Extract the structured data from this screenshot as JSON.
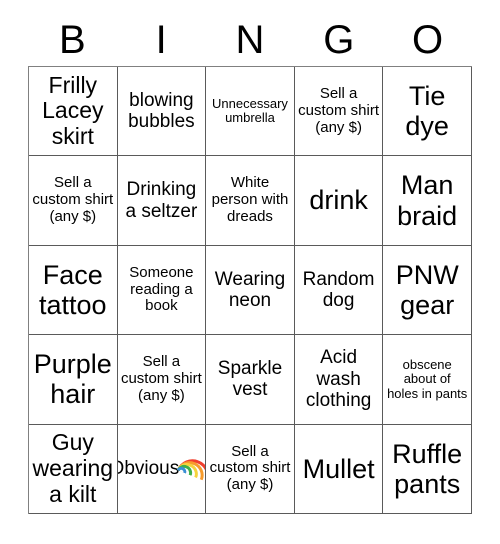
{
  "card": {
    "title": "BINGO",
    "header_letters": [
      "B",
      "I",
      "N",
      "G",
      "O"
    ],
    "background_color": "#ffffff",
    "text_color": "#000000",
    "border_color": "#5a5a5a",
    "rows": [
      [
        {
          "text": "Frilly Lacey skirt",
          "size": "lg"
        },
        {
          "text": "blowing bubbles",
          "size": "md"
        },
        {
          "text": "Unnecessary umbrella",
          "size": "xs"
        },
        {
          "text": "Sell a custom shirt (any $)",
          "size": "sm"
        },
        {
          "text": "Tie dye",
          "size": "xl"
        }
      ],
      [
        {
          "text": "Sell a custom shirt (any $)",
          "size": "sm"
        },
        {
          "text": "Drinking a seltzer",
          "size": "md"
        },
        {
          "text": "White person with dreads",
          "size": "sm"
        },
        {
          "text": "drink",
          "size": "xl"
        },
        {
          "text": "Man braid",
          "size": "xl"
        }
      ],
      [
        {
          "text": "Face tattoo",
          "size": "xl"
        },
        {
          "text": "Someone reading a book",
          "size": "sm"
        },
        {
          "text": "Wearing neon",
          "size": "md"
        },
        {
          "text": "Random dog",
          "size": "md"
        },
        {
          "text": "PNW gear",
          "size": "xl"
        }
      ],
      [
        {
          "text": "Purple hair",
          "size": "xl"
        },
        {
          "text": "Sell a custom shirt (any $)",
          "size": "sm"
        },
        {
          "text": "Sparkle vest",
          "size": "md"
        },
        {
          "text": "Acid wash clothing",
          "size": "md"
        },
        {
          "text": "obscene about of holes in pants",
          "size": "xs"
        }
      ],
      [
        {
          "text": "Guy wearing a kilt",
          "size": "lg"
        },
        {
          "text": "Obvious",
          "size": "md",
          "emoji": "rainbow"
        },
        {
          "text": "Sell a custom shirt (any $)",
          "size": "sm"
        },
        {
          "text": "Mullet",
          "size": "xl"
        },
        {
          "text": "Ruffle pants",
          "size": "xl"
        }
      ]
    ]
  }
}
